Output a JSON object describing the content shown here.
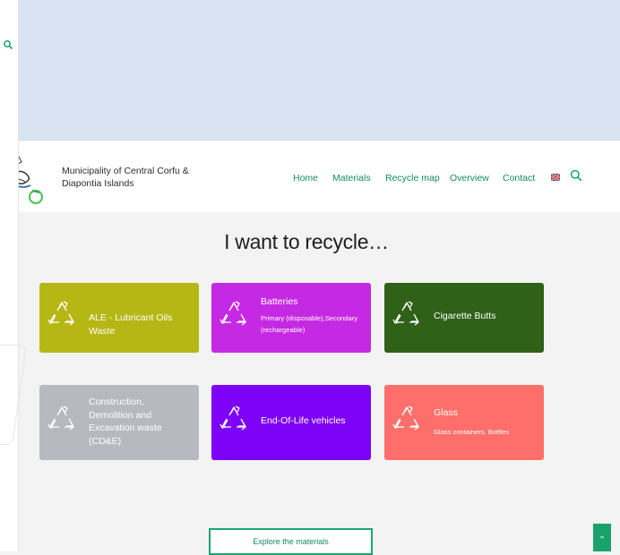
{
  "header": {
    "site_name": "Municipality of Central Corfu & Diapontia Islands",
    "nav": [
      "Home",
      "Materials",
      "Recycle map",
      "Overview",
      "Contact"
    ]
  },
  "icons": [
    "search-icon",
    "logo-icon",
    "recycle-icon",
    "uk-flag-icon",
    "chevron-up-icon"
  ],
  "heading": "I want to recycle…",
  "cards": [
    {
      "title": "ALE - Lubricant Oils Waste",
      "subtitle": "",
      "color": "#b6b615"
    },
    {
      "title": "Batteries",
      "subtitle": "Primary (disposable),Secondary (rechargeable)",
      "color": "#c629e3"
    },
    {
      "title": "Cigarette Butts",
      "subtitle": "",
      "color": "#2f6118"
    },
    {
      "title": "Construction, Demolition and Excavation waste (CD&E)",
      "subtitle": "",
      "color": "#b7b9c1"
    },
    {
      "title": "End-Of-Life vehicles",
      "subtitle": "",
      "color": "#7e02f7"
    },
    {
      "title": "Glass",
      "subtitle": "Glass containers, Bottles",
      "color": "#fe6f6b"
    }
  ],
  "explore_label": "Explore the materials",
  "colors": {
    "accent": "#128a5e",
    "banner": "#d9e4f3"
  }
}
